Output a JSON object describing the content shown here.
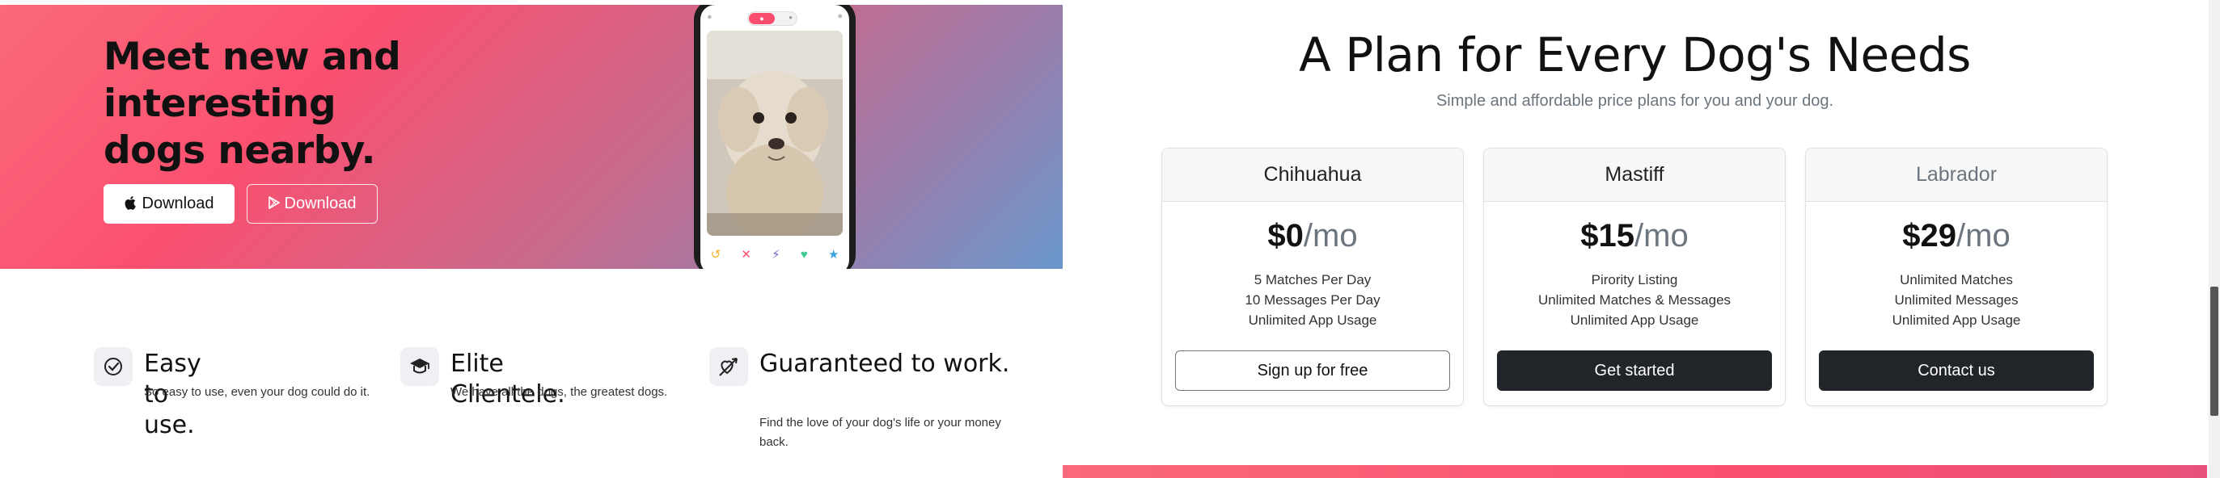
{
  "hero": {
    "title": "Meet new and interesting dogs nearby.",
    "apple_download": "Download",
    "play_download": "Download",
    "apple_icon": "apple-icon",
    "play_icon": "play-store-icon"
  },
  "features": [
    {
      "icon": "check-circle-icon",
      "title": "Easy to use.",
      "text": "So easy to use, even your dog could do it."
    },
    {
      "icon": "graduation-cap-icon",
      "title": "Elite Clientele.",
      "text": "We have all the dogs, the greatest dogs."
    },
    {
      "icon": "heart-arrow-icon",
      "title": "Guaranteed to work.",
      "text": "Find the love of your dog's life or your money back."
    }
  ],
  "pricing": {
    "title": "A Plan for Every Dog's Needs",
    "subtitle": "Simple and affordable price plans for you and your dog.",
    "plans": [
      {
        "name": "Chihuahua",
        "price": "$0",
        "period": "/mo",
        "features": [
          "5 Matches Per Day",
          "10 Messages Per Day",
          "Unlimited App Usage"
        ],
        "button": "Sign up for free"
      },
      {
        "name": "Mastiff",
        "price": "$15",
        "period": "/mo",
        "features": [
          "Pirority Listing",
          "Unlimited Matches & Messages",
          "Unlimited App Usage"
        ],
        "button": "Get started"
      },
      {
        "name": "Labrador",
        "price": "$29",
        "period": "/mo",
        "features": [
          "Unlimited Matches",
          "Unlimited Messages",
          "Unlimited App Usage"
        ],
        "button": "Contact us"
      }
    ]
  },
  "colors": {
    "brand": "#fb4d6d",
    "gradient_end": "#6a98cc",
    "dark_button": "#212529",
    "muted_text": "#6c757d"
  }
}
